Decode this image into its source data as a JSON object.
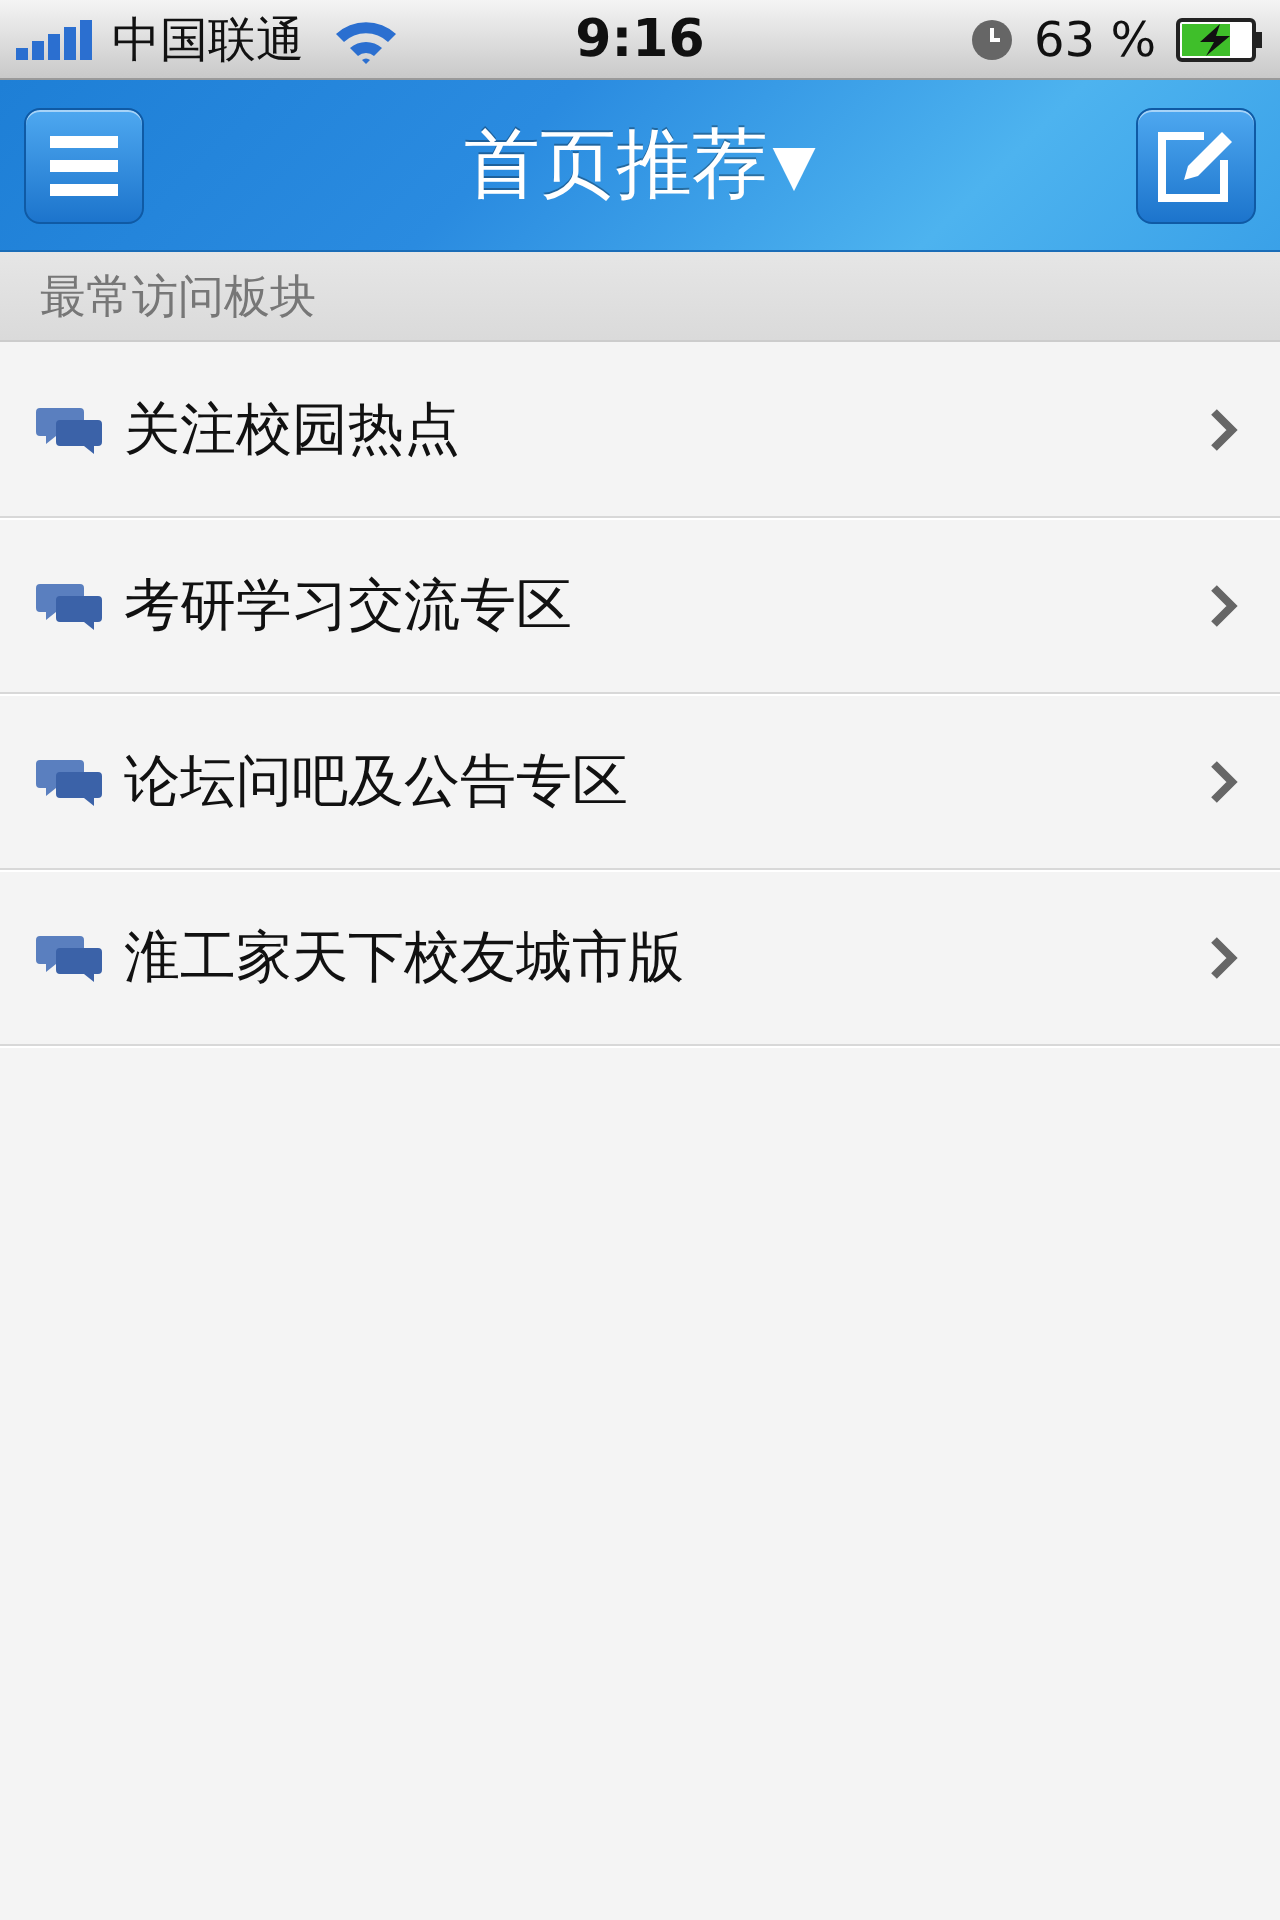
{
  "status_bar": {
    "carrier": "中国联通",
    "time": "9:16",
    "battery": "63 %"
  },
  "nav_bar": {
    "title": "首页推荐",
    "title_arrow": "▼"
  },
  "section": {
    "title": "最常访问板块"
  },
  "forums": [
    {
      "name": "关注校园热点"
    },
    {
      "name": "考研学习交流专区"
    },
    {
      "name": "论坛问吧及公告专区"
    },
    {
      "name": "淮工家天下校友城市版"
    }
  ]
}
